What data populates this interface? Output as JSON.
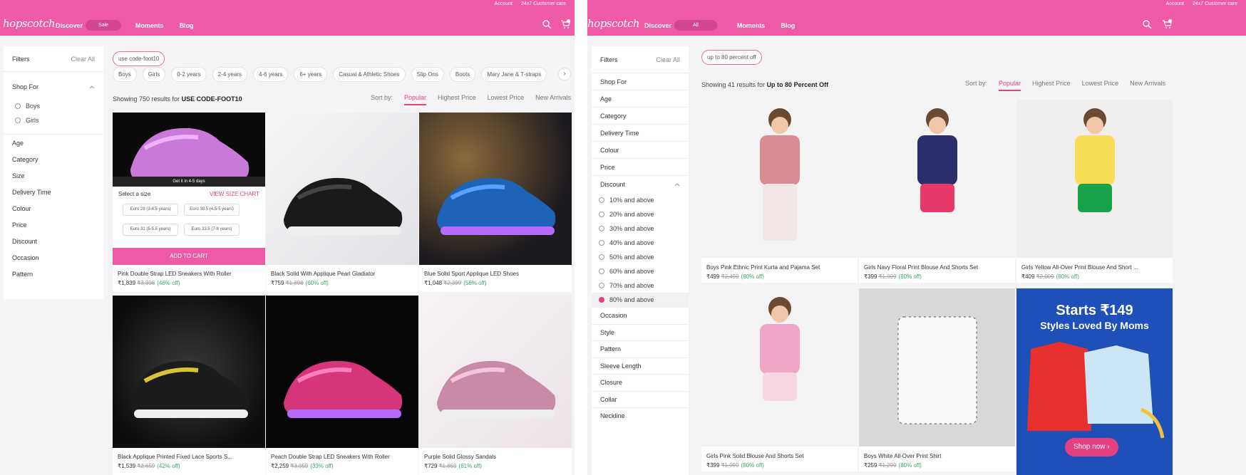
{
  "left": {
    "toplinks": [
      "Account",
      "24x7 Customer care"
    ],
    "logo": "hopscotch",
    "nav": {
      "discover": "Discover",
      "discover_pill": "Sale",
      "moments": "Moments",
      "blog": "Blog"
    },
    "filters": {
      "title": "Filters",
      "clear": "Clear All",
      "shop_for": "Shop For",
      "options": [
        "Boys",
        "Girls"
      ],
      "items": [
        "Age",
        "Category",
        "Size",
        "Delivery Time",
        "Colour",
        "Price",
        "Discount",
        "Occasion",
        "Pattern"
      ]
    },
    "code_chip": "use code-foot10",
    "chips": [
      "Boys",
      "Girls",
      "0-2 years",
      "2-4 years",
      "4-6 years",
      "6+ years",
      "Casual & Athletic Shoes",
      "Slip Ons",
      "Boots",
      "Mary Jane & T-straps"
    ],
    "results": {
      "prefix": "Showing 750 results for",
      "query": "USE CODE-FOOT10"
    },
    "sort": {
      "label": "Sort by:",
      "options": [
        "Popular",
        "Highest Price",
        "Lowest Price",
        "New Arrivals"
      ]
    },
    "quickview": {
      "delivery": "Get it in 4-5 days",
      "select_size": "Select a size",
      "size_chart": "VIEW SIZE CHART",
      "sizes": [
        "Euro 29 (3-4.5 years)",
        "Euro 30.5 (4.5-5 years)",
        "Euro 31 (5-5.5 years)",
        "Euro 33.5 (7-8 years)"
      ],
      "add_to_cart": "ADD TO CART"
    },
    "products": [
      {
        "title": "Pink Double Strap LED Sneakers With Roller",
        "price": "₹1,839",
        "mrp": "₹3,398",
        "off": "(46% off)"
      },
      {
        "title": "Black Solid With Applique Pearl Gladiator",
        "price": "₹759",
        "mrp": "₹1,898",
        "off": "(60% off)"
      },
      {
        "title": "Blue Solid Sport Applique LED Shoes",
        "price": "₹1,048",
        "mrp": "₹2,399",
        "off": "(56% off)"
      },
      {
        "title": "Black Applique Printed Fixed Lace Sports S...",
        "price": "₹1,539",
        "mrp": "₹2,659",
        "off": "(42% off)"
      },
      {
        "title": "Peach Double Strap LED Sneakers With Roller",
        "price": "₹2,259",
        "mrp": "₹3,359",
        "off": "(33% off)"
      },
      {
        "title": "Purple Solid Glossy Sandals",
        "price": "₹729",
        "mrp": "₹1,859",
        "off": "(61% off)"
      }
    ]
  },
  "right": {
    "toplinks": [
      "Account",
      "24x7 Customer care"
    ],
    "logo": "hopscotch",
    "nav": {
      "discover": "Discover",
      "discover_pill": "All",
      "moments": "Moments",
      "blog": "Blog"
    },
    "filters": {
      "title": "Filters",
      "clear": "Clear All",
      "items_top": [
        "Shop For",
        "Age",
        "Category",
        "Delivery Time",
        "Colour",
        "Price"
      ],
      "discount": "Discount",
      "discount_options": [
        "10% and above",
        "20% and above",
        "30% and above",
        "40% and above",
        "50% and above",
        "60% and above",
        "70% and above",
        "80% and above"
      ],
      "items_bottom": [
        "Occasion",
        "Style",
        "Pattern",
        "Sleeve Length",
        "Closure",
        "Collar",
        "Neckline"
      ]
    },
    "offer_chip": "up to 80 percent off",
    "results": {
      "prefix": "Showing 41 results for",
      "query": "Up to 80 Percent Off"
    },
    "sort": {
      "label": "Sort by:",
      "options": [
        "Popular",
        "Highest Price",
        "Lowest Price",
        "New Arrivals"
      ]
    },
    "products": [
      {
        "title": "Boys Pink Ethnic Print Kurta and Pajama Set",
        "price": "₹499",
        "mrp": "₹2,499",
        "off": "(80% off)"
      },
      {
        "title": "Girls Navy Floral Print Blouse And Shorts Set",
        "price": "₹399",
        "mrp": "₹1,999",
        "off": "(80% off)"
      },
      {
        "title": "Girls Yellow All-Over Print Blouse And Short ...",
        "price": "₹409",
        "mrp": "₹2,009",
        "off": "(80% off)"
      },
      {
        "title": "Girls Pink Solid Blouse And Shorts Set",
        "price": "₹399",
        "mrp": "₹1,999",
        "off": "(80% off)"
      },
      {
        "title": "Boys White All-Over Print Shirt",
        "price": "₹259",
        "mrp": "₹1,299",
        "off": "(80% off)"
      }
    ],
    "banner": {
      "headline": "Starts ₹149",
      "sub": "Styles Loved By Moms",
      "cta": "Shop now ›"
    }
  }
}
